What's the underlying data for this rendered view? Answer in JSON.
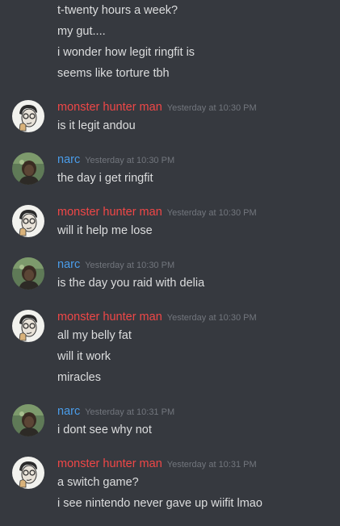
{
  "continuation": [
    "t-twenty hours a week?",
    "my gut....",
    "i wonder how legit ringfit is",
    "seems like torture tbh"
  ],
  "messages": [
    {
      "author": "monster hunter man",
      "color": "#f04747",
      "avatar": "sketch-avatar",
      "time": "Yesterday at 10:30 PM",
      "lines": [
        "is it legit andou"
      ]
    },
    {
      "author": "narc",
      "color": "#4a9dea",
      "avatar": "photo-avatar",
      "time": "Yesterday at 10:30 PM",
      "lines": [
        "the day i get ringfit"
      ]
    },
    {
      "author": "monster hunter man",
      "color": "#f04747",
      "avatar": "sketch-avatar",
      "time": "Yesterday at 10:30 PM",
      "lines": [
        "will it help me lose"
      ]
    },
    {
      "author": "narc",
      "color": "#4a9dea",
      "avatar": "photo-avatar",
      "time": "Yesterday at 10:30 PM",
      "lines": [
        "is the day you raid with delia"
      ]
    },
    {
      "author": "monster hunter man",
      "color": "#f04747",
      "avatar": "sketch-avatar",
      "time": "Yesterday at 10:30 PM",
      "lines": [
        "all my belly fat",
        "will it work",
        "miracles"
      ]
    },
    {
      "author": "narc",
      "color": "#4a9dea",
      "avatar": "photo-avatar",
      "time": "Yesterday at 10:31 PM",
      "lines": [
        "i dont see why not"
      ]
    },
    {
      "author": "monster hunter man",
      "color": "#f04747",
      "avatar": "sketch-avatar",
      "time": "Yesterday at 10:31 PM",
      "lines": [
        "a switch game?",
        "i see nintendo never gave up wiifit lmao"
      ]
    }
  ]
}
